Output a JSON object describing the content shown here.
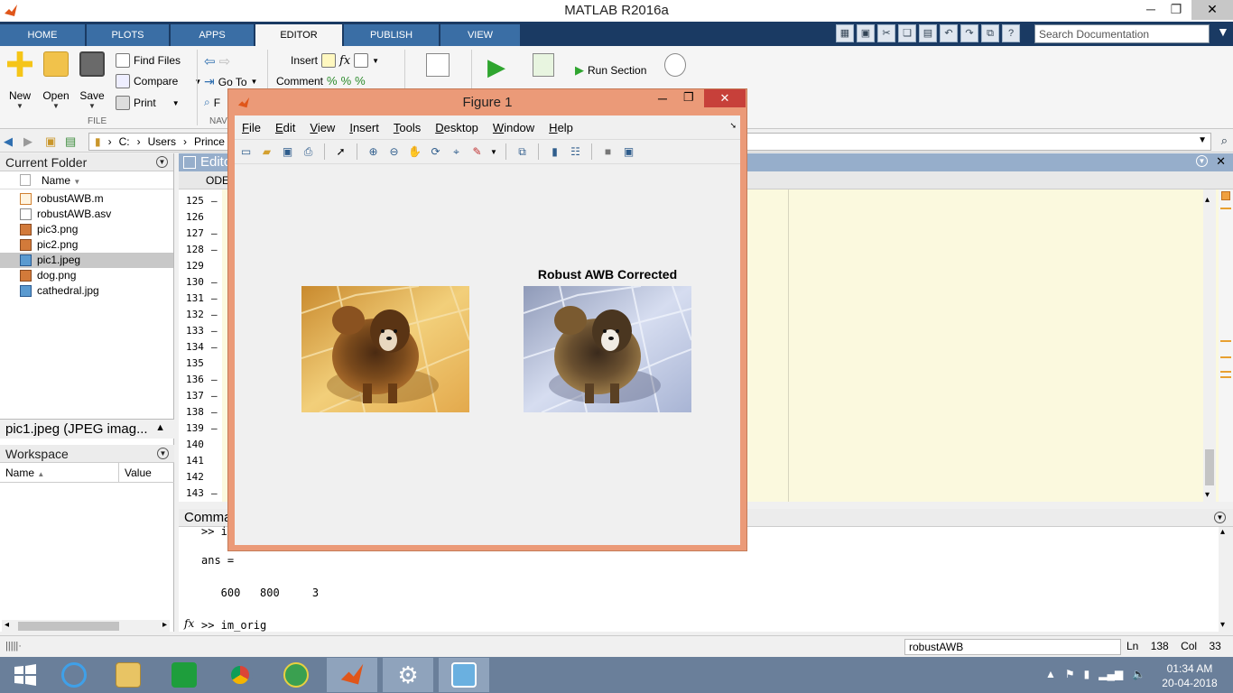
{
  "app": {
    "title": "MATLAB R2016a"
  },
  "window_controls": {
    "minimize": "─",
    "maximize": "❐",
    "close": "✕"
  },
  "tabs": [
    {
      "label": "HOME",
      "active": false
    },
    {
      "label": "PLOTS",
      "active": false
    },
    {
      "label": "APPS",
      "active": false
    },
    {
      "label": "EDITOR",
      "active": true
    },
    {
      "label": "PUBLISH",
      "active": false
    },
    {
      "label": "VIEW",
      "active": false
    }
  ],
  "search": {
    "placeholder": "Search Documentation"
  },
  "ribbon": {
    "file_section": {
      "new": "New",
      "open": "Open",
      "save": "Save",
      "find_files": "Find Files",
      "compare": "Compare",
      "print": "Print",
      "label": "FILE"
    },
    "navigate_section": {
      "go_to": "Go To",
      "find": "F",
      "label": "NAV"
    },
    "edit_section": {
      "insert": "Insert",
      "comment": "Comment",
      "fx": "fx"
    },
    "run_section": {
      "run_section": "Run Section"
    }
  },
  "address": {
    "parts": [
      "C:",
      "Users",
      "Prince"
    ]
  },
  "current_folder": {
    "title": "Current Folder",
    "column_name": "Name",
    "files": [
      {
        "name": "robustAWB.m",
        "icon": "m-file-icon",
        "selected": false
      },
      {
        "name": "robustAWB.asv",
        "icon": "blank-file-icon",
        "selected": false
      },
      {
        "name": "pic3.png",
        "icon": "image-file-icon",
        "selected": false
      },
      {
        "name": "pic2.png",
        "icon": "image-file-icon",
        "selected": false
      },
      {
        "name": "pic1.jpeg",
        "icon": "image-file-icon",
        "selected": true
      },
      {
        "name": "dog.png",
        "icon": "image-file-icon",
        "selected": false
      },
      {
        "name": "cathedral.jpg",
        "icon": "image-file-icon",
        "selected": false
      }
    ],
    "details": "pic1.jpeg  (JPEG imag..."
  },
  "workspace": {
    "title": "Workspace",
    "col_name": "Name",
    "col_value": "Value"
  },
  "editor": {
    "title": "Edito",
    "tab": "ODE",
    "line_numbers": [
      "125",
      "126",
      "127",
      "128",
      "129",
      "130",
      "131",
      "132",
      "133",
      "134",
      "135",
      "136",
      "137",
      "138",
      "139",
      "140",
      "141",
      "142",
      "143"
    ],
    "dashed_lines": [
      "125",
      "127",
      "128",
      "130",
      "131",
      "132",
      "133",
      "134",
      "136",
      "137",
      "138",
      "139",
      "143"
    ]
  },
  "command_window": {
    "title": "Comma",
    "lines": [
      ">> i",
      "ans =",
      "   600   800     3"
    ],
    "prompt": ">> im_orig",
    "fx": "fx"
  },
  "statusbar": {
    "file": "robustAWB",
    "ln_label": "Ln",
    "ln": "138",
    "col_label": "Col",
    "col": "33"
  },
  "figure": {
    "title": "Figure 1",
    "menu": [
      "File",
      "Edit",
      "View",
      "Insert",
      "Tools",
      "Desktop",
      "Window",
      "Help"
    ],
    "menu_underline": [
      "F",
      "E",
      "V",
      "I",
      "T",
      "D",
      "W",
      "H"
    ],
    "axes_title": "Robust AWB Corrected"
  },
  "taskbar": {
    "time": "01:34 AM",
    "date": "20-04-2018"
  }
}
